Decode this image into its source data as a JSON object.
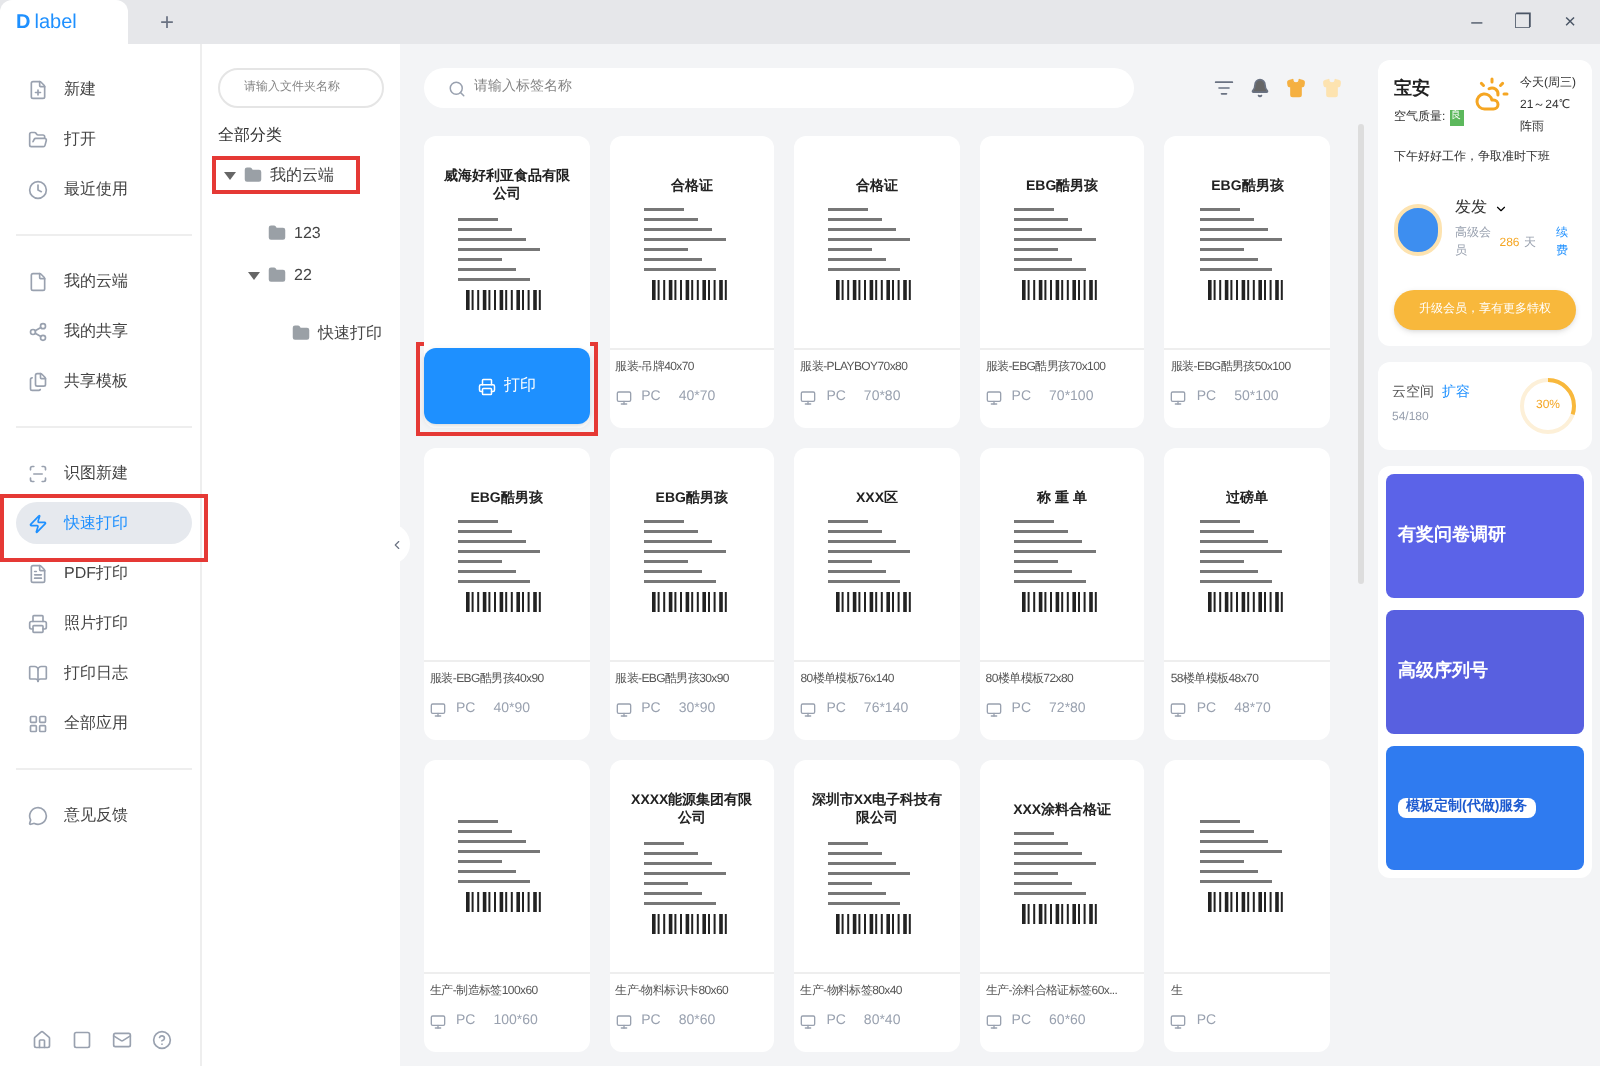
{
  "window": {
    "logo_mark": "D",
    "app_name": "label",
    "new_tab": "+",
    "controls": [
      "–",
      "❐",
      "×"
    ]
  },
  "sidebar": {
    "groups": [
      [
        {
          "label": "新建",
          "selected": false
        },
        {
          "label": "打开",
          "selected": false
        },
        {
          "label": "最近使用",
          "selected": false
        }
      ],
      [
        {
          "label": "我的云端",
          "selected": false
        },
        {
          "label": "我的共享",
          "selected": false
        },
        {
          "label": "共享模板",
          "selected": false
        }
      ],
      [
        {
          "label": "识图新建",
          "selected": false
        },
        {
          "label": "快速打印",
          "selected": true
        },
        {
          "label": "PDF打印",
          "selected": false
        },
        {
          "label": "照片打印",
          "selected": false
        },
        {
          "label": "打印日志",
          "selected": false
        },
        {
          "label": "全部应用",
          "selected": false
        }
      ],
      [
        {
          "label": "意见反馈",
          "selected": false
        }
      ]
    ]
  },
  "folders": {
    "search_placeholder": "请输入文件夹名称",
    "heading": "全部分类",
    "tree": [
      {
        "label": "我的云端",
        "expanded": true,
        "highlighted": true,
        "children": [
          {
            "label": "123"
          },
          {
            "label": "22",
            "expanded": true,
            "children": [
              {
                "label": "快速打印"
              }
            ]
          }
        ]
      }
    ]
  },
  "main": {
    "search_placeholder": "请输入标签名称",
    "templates": [
      {
        "preview_title": "威海好利亚食品有限公司",
        "hovered": true,
        "action": "打印"
      },
      {
        "name": "服装-吊牌40x70",
        "device": "PC",
        "size": "40*70",
        "preview_title": "合格证",
        "hovered": false
      },
      {
        "name": "服装-PLAYBOY70x80",
        "device": "PC",
        "size": "70*80",
        "preview_title": "合格证",
        "hovered": false
      },
      {
        "name": "服装-EBG酷男孩70x100",
        "device": "PC",
        "size": "70*100",
        "preview_title": "EBG酷男孩",
        "hovered": false
      },
      {
        "name": "服装-EBG酷男孩50x100",
        "device": "PC",
        "size": "50*100",
        "preview_title": "EBG酷男孩",
        "hovered": false
      },
      {
        "name": "服装-EBG酷男孩40x90",
        "device": "PC",
        "size": "40*90",
        "preview_title": "EBG酷男孩",
        "hovered": false
      },
      {
        "name": "服装-EBG酷男孩30x90",
        "device": "PC",
        "size": "30*90",
        "preview_title": "EBG酷男孩",
        "hovered": false
      },
      {
        "name": "80楼单模板76x140",
        "device": "PC",
        "size": "76*140",
        "preview_title": "XXX区",
        "hovered": false
      },
      {
        "name": "80楼单模板72x80",
        "device": "PC",
        "size": "72*80",
        "preview_title": "称 重 单",
        "hovered": false
      },
      {
        "name": "58楼单模板48x70",
        "device": "PC",
        "size": "48*70",
        "preview_title": "过磅单",
        "hovered": false
      },
      {
        "name": "生产-制造标签100x60",
        "device": "PC",
        "size": "100*60",
        "hovered": false
      },
      {
        "name": "生产-物料标识卡80x60",
        "device": "PC",
        "size": "80*60",
        "preview_title": "XXXX能源集团有限公司",
        "hovered": false
      },
      {
        "name": "生产-物料标签80x40",
        "device": "PC",
        "size": "80*40",
        "preview_title": "深圳市XX电子科技有限公司",
        "hovered": false
      },
      {
        "name": "生产-涂料合格证标签60x...",
        "device": "PC",
        "size": "60*60",
        "preview_title": "XXX涂料合格证",
        "hovered": false
      },
      {
        "name": "生",
        "device": "PC",
        "hovered": false
      }
    ]
  },
  "right_panel": {
    "weather": {
      "city": "宝安",
      "air_label": "空气质量:",
      "air_value": "良",
      "greeting": "下午好好工作，争取准时下班",
      "day": "今天(周三)",
      "temp": "21～24℃",
      "condition": "阵雨"
    },
    "user": {
      "name": "发发",
      "member": "高级会员",
      "days": "286",
      "days_unit": "天",
      "renew": "续费"
    },
    "upgrade": "升级会员，享有更多特权",
    "cloud": {
      "label": "云空间",
      "expand": "扩容",
      "usage": "54/180",
      "percent": "30%",
      "level": 0.3
    },
    "banners": [
      {
        "title": "有奖问卷调研",
        "kind": "survey"
      },
      {
        "title": "高级序列号",
        "kind": "serial"
      },
      {
        "title": "模板定制(代做)服务",
        "kind": "custom"
      }
    ]
  }
}
